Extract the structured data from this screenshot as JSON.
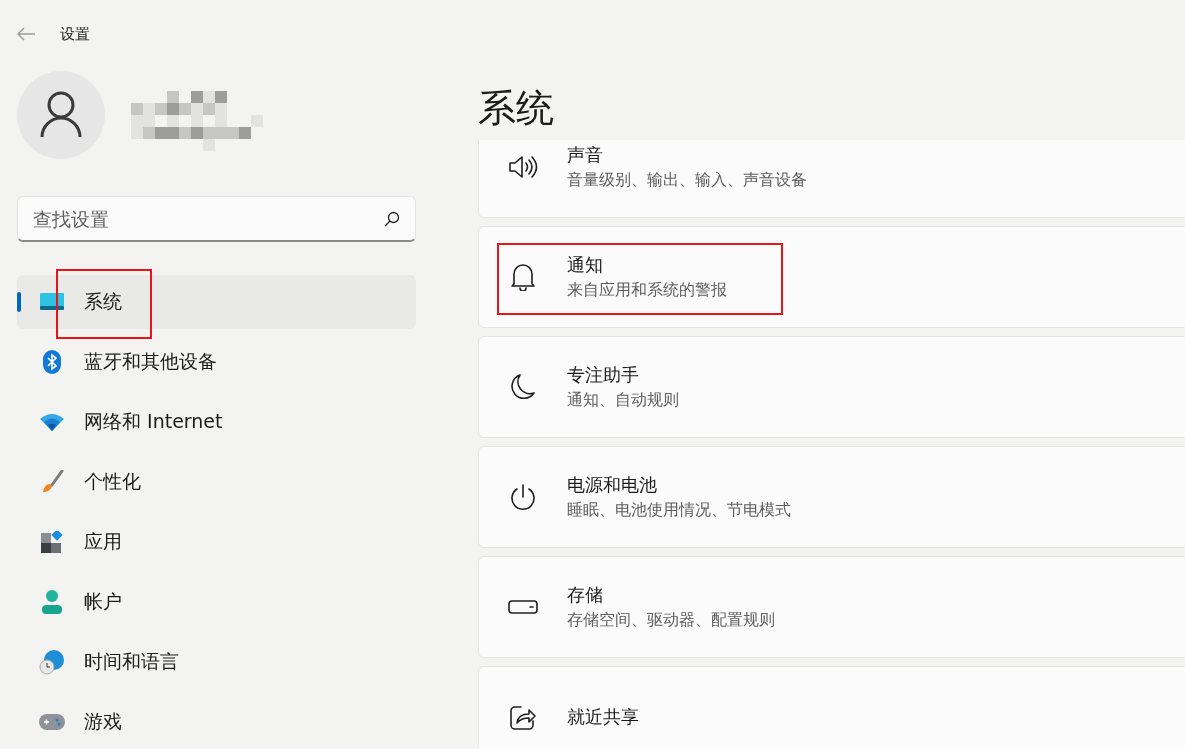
{
  "window": {
    "title": "设置"
  },
  "search": {
    "placeholder": "查找设置"
  },
  "nav": [
    {
      "label": "系统",
      "kind": "system",
      "selected": true,
      "highlighted": true
    },
    {
      "label": "蓝牙和其他设备",
      "kind": "bluetooth",
      "selected": false,
      "highlighted": false
    },
    {
      "label": "网络和 Internet",
      "kind": "network",
      "selected": false,
      "highlighted": false
    },
    {
      "label": "个性化",
      "kind": "brush",
      "selected": false,
      "highlighted": false
    },
    {
      "label": "应用",
      "kind": "apps",
      "selected": false,
      "highlighted": false
    },
    {
      "label": "帐户",
      "kind": "account",
      "selected": false,
      "highlighted": false
    },
    {
      "label": "时间和语言",
      "kind": "time",
      "selected": false,
      "highlighted": false
    },
    {
      "label": "游戏",
      "kind": "game",
      "selected": false,
      "highlighted": false
    }
  ],
  "page": {
    "title": "系统"
  },
  "cards": [
    {
      "kind": "sound",
      "title": "声音",
      "subtitle": "音量级别、输出、输入、声音设备",
      "highlighted": false
    },
    {
      "kind": "bell",
      "title": "通知",
      "subtitle": "来自应用和系统的警报",
      "highlighted": true
    },
    {
      "kind": "moon",
      "title": "专注助手",
      "subtitle": "通知、自动规则",
      "highlighted": false
    },
    {
      "kind": "power",
      "title": "电源和电池",
      "subtitle": "睡眠、电池使用情况、节电模式",
      "highlighted": false
    },
    {
      "kind": "storage",
      "title": "存储",
      "subtitle": "存储空间、驱动器、配置规则",
      "highlighted": false
    },
    {
      "kind": "share",
      "title": "就近共享",
      "highlighted": false
    }
  ]
}
